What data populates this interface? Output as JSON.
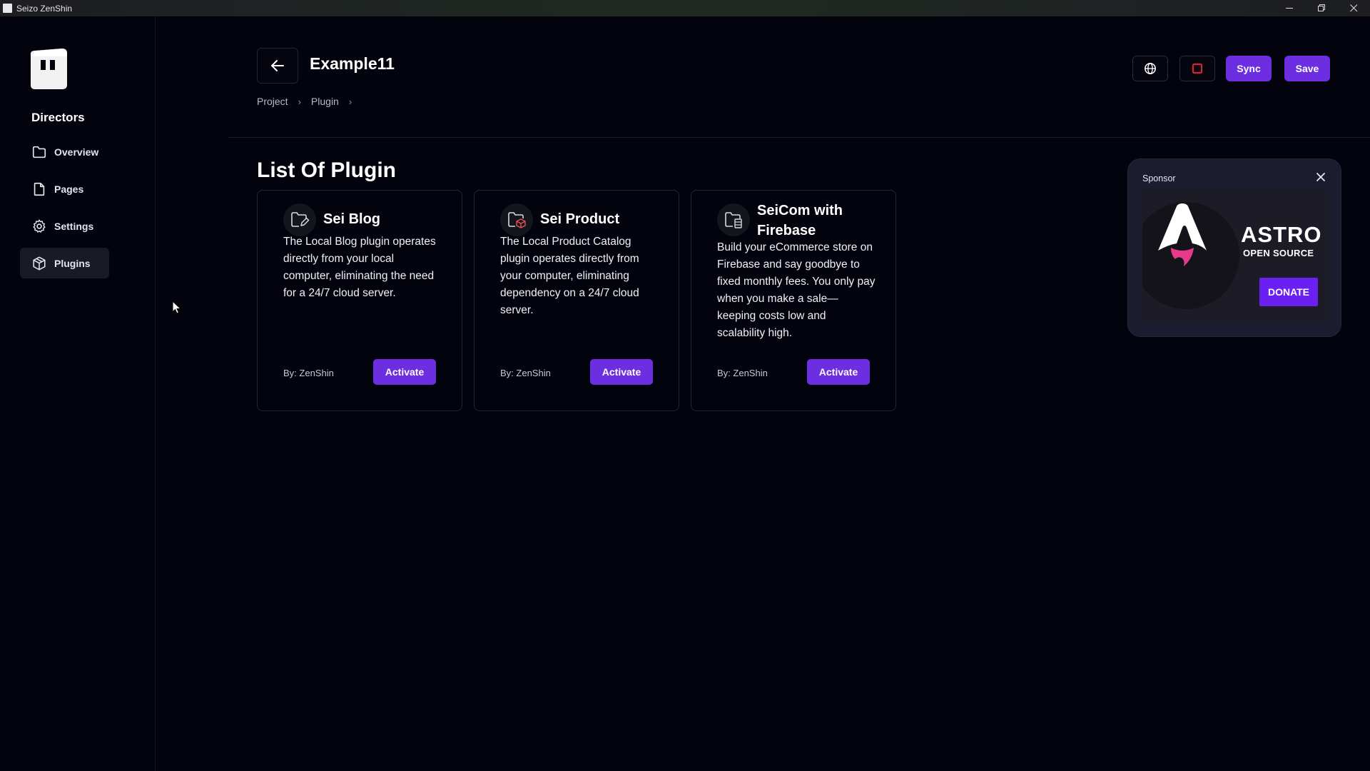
{
  "window": {
    "title": "Seizo ZenShin",
    "controls": [
      "minimize",
      "restore",
      "close"
    ]
  },
  "sidebar": {
    "heading": "Directors",
    "items": [
      {
        "label": "Overview",
        "icon": "folder-icon",
        "active": false
      },
      {
        "label": "Pages",
        "icon": "file-icon",
        "active": false
      },
      {
        "label": "Settings",
        "icon": "gear-icon",
        "active": false
      },
      {
        "label": "Plugins",
        "icon": "package-icon",
        "active": true
      }
    ]
  },
  "header": {
    "title": "Example11",
    "breadcrumb": [
      "Project",
      "Plugin"
    ],
    "buttons": {
      "globe_icon": "globe-icon",
      "stop_icon": "stop-icon",
      "sync_label": "Sync",
      "save_label": "Save"
    }
  },
  "main": {
    "section_title": "List Of Plugin",
    "plugins": [
      {
        "name": "Sei Blog",
        "icon": "folder-edit-icon",
        "description": "The Local Blog plugin operates directly from your local computer, eliminating the need for a 24/7 cloud server.",
        "author": "By: ZenShin",
        "action_label": "Activate"
      },
      {
        "name": "Sei Product",
        "icon": "folder-box-icon",
        "description": "The Local Product Catalog plugin operates directly from your computer, eliminating dependency on a 24/7 cloud server.",
        "author": "By: ZenShin",
        "action_label": "Activate"
      },
      {
        "name": "SeiCom with Firebase",
        "icon": "folder-database-icon",
        "description": "Build your eCommerce store on Firebase and say goodbye to fixed monthly fees. You only pay when you make a sale—keeping costs low and scalability high.",
        "author": "By: ZenShin",
        "action_label": "Activate"
      }
    ]
  },
  "sponsor": {
    "label": "Sponsor",
    "ad": {
      "name": "ASTRO",
      "subtitle": "OPEN SOURCE",
      "button_label": "DONATE"
    }
  },
  "colors": {
    "background": "#03030e",
    "accent": "#6c2ee0",
    "stop_red": "#e0202a",
    "astro_pink": "#e83a8a"
  }
}
